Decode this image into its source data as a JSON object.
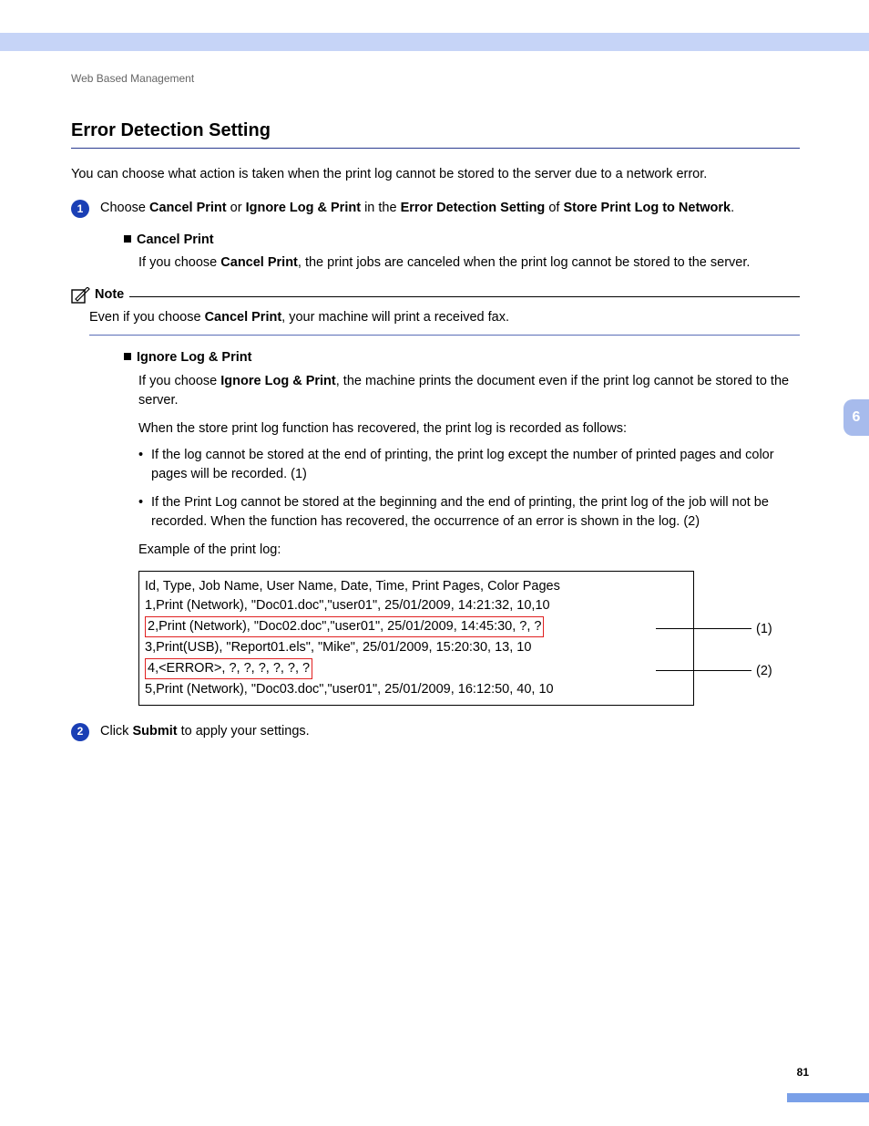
{
  "breadcrumb": "Web Based Management",
  "section_title": "Error Detection Setting",
  "chapter_tab": "6",
  "page_number": "81",
  "intro": "You can choose what action is taken when the print log cannot be stored to the server due to a network error.",
  "step1": {
    "num": "1",
    "pre": "Choose ",
    "b1": "Cancel Print",
    "mid1": " or ",
    "b2": "Ignore Log & Print",
    "mid2": " in the ",
    "b3": "Error Detection Setting",
    "mid3": " of ",
    "b4": "Store Print Log to Network",
    "post": "."
  },
  "cancel": {
    "head": "Cancel Print",
    "body_pre": "If you choose ",
    "body_b": "Cancel Print",
    "body_post": ", the print jobs are canceled when the print log cannot be stored to the server."
  },
  "note": {
    "label": "Note",
    "body_pre": "Even if you choose ",
    "body_b": "Cancel Print",
    "body_post": ", your machine will print a received fax."
  },
  "ignore": {
    "head": "Ignore Log & Print",
    "body_pre": "If you choose ",
    "body_b": "Ignore Log & Print",
    "body_post": ", the machine prints the document even if the print log cannot be stored to the server.",
    "recovered": "When the store print log function has recovered, the print log is recorded as follows:",
    "bullet1": "If the log cannot be stored at the end of printing, the print log except the number of printed pages and color pages will be recorded. (1)",
    "bullet2": "If the Print Log cannot be stored at the beginning and the end of printing, the print log of the job will not be recorded. When the function has recovered, the occurrence of an error is shown in the log. (2)",
    "example_label": "Example of the print log:"
  },
  "log": {
    "h": "Id, Type, Job Name, User Name, Date, Time, Print Pages, Color Pages",
    "r1": "1,Print (Network), \"Doc01.doc\",\"user01\", 25/01/2009, 14:21:32, 10,10",
    "r2": "2,Print (Network), \"Doc02.doc\",\"user01\", 25/01/2009, 14:45:30, ?, ?",
    "r3": "3,Print(USB), \"Report01.els\", \"Mike\", 25/01/2009, 15:20:30, 13, 10",
    "r4": "4,<ERROR>, ?, ?, ?, ?, ?, ?",
    "r5": "5,Print (Network), \"Doc03.doc\",\"user01\", 25/01/2009, 16:12:50, 40, 10"
  },
  "callout1": "(1)",
  "callout2": "(2)",
  "step2": {
    "num": "2",
    "pre": "Click ",
    "b1": "Submit",
    "post": " to apply your settings."
  }
}
